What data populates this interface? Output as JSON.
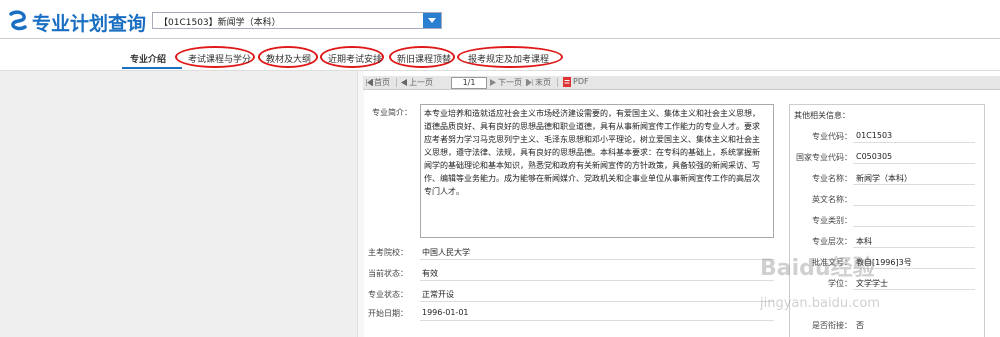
{
  "app": {
    "title": "专业计划查询"
  },
  "selector": {
    "value": "【01C1503】新闻学（本科）"
  },
  "tabs": [
    {
      "label": "专业介绍"
    },
    {
      "label": "考试课程与学分"
    },
    {
      "label": "教材及大纲"
    },
    {
      "label": "近期考试安排"
    },
    {
      "label": "新旧课程顶替"
    },
    {
      "label": "报考规定及加考课程"
    }
  ],
  "toolbar": {
    "first": "首页",
    "prev": "上一页",
    "page": "1/1",
    "next": "下一页",
    "last": "末页",
    "pdf": "PDF"
  },
  "intro": {
    "label": "专业简介：",
    "text": "本专业培养和造就适应社会主义市场经济建设需要的，有爱国主义、集体主义和社会主义思想，道德品质良好、具有良好的思想品德和职业道德，具有从事新闻宣传工作能力的专业人才。要求应考者努力学习马克思列宁主义、毛泽东思想和邓小平理论，树立爱国主义、集体主义和社会主义思想，遵守法律、法规，具有良好的思想品德。本科基本要求：在专科的基础上，系统掌握新闻学的基础理论和基本知识，熟悉党和政府有关新闻宣传的方针政策，具备较强的新闻采访、写作、编辑等业务能力。成为能够在新闻媒介、党政机关和企事业单位从事新闻宣传工作的高层次专门人才。"
  },
  "details": [
    {
      "label": "主考院校：",
      "value": "中国人民大学"
    },
    {
      "label": "当前状态：",
      "value": "有效"
    },
    {
      "label": "专业状态：",
      "value": "正常开设"
    },
    {
      "label": "开始日期：",
      "value": "1996-01-01"
    }
  ],
  "side": {
    "title": "其他相关信息：",
    "rows": [
      {
        "label": "专业代码：",
        "value": "01C1503"
      },
      {
        "label": "国家专业代码：",
        "value": "C050305"
      },
      {
        "label": "专业名称：",
        "value": "新闻学（本科）"
      },
      {
        "label": "英文名称：",
        "value": ""
      },
      {
        "label": "专业类别：",
        "value": ""
      },
      {
        "label": "专业层次：",
        "value": "本科"
      },
      {
        "label": "批准文号：",
        "value": "教自[1996]3号"
      },
      {
        "label": "学位：",
        "value": "文学学士"
      },
      {
        "label": "是否衔接：",
        "value": "否"
      }
    ]
  },
  "watermark": {
    "brand": "Baidu经验",
    "url": "jingyan.baidu.com"
  },
  "colors": {
    "accent": "#1a6fc2",
    "annotation": "#e01818"
  }
}
